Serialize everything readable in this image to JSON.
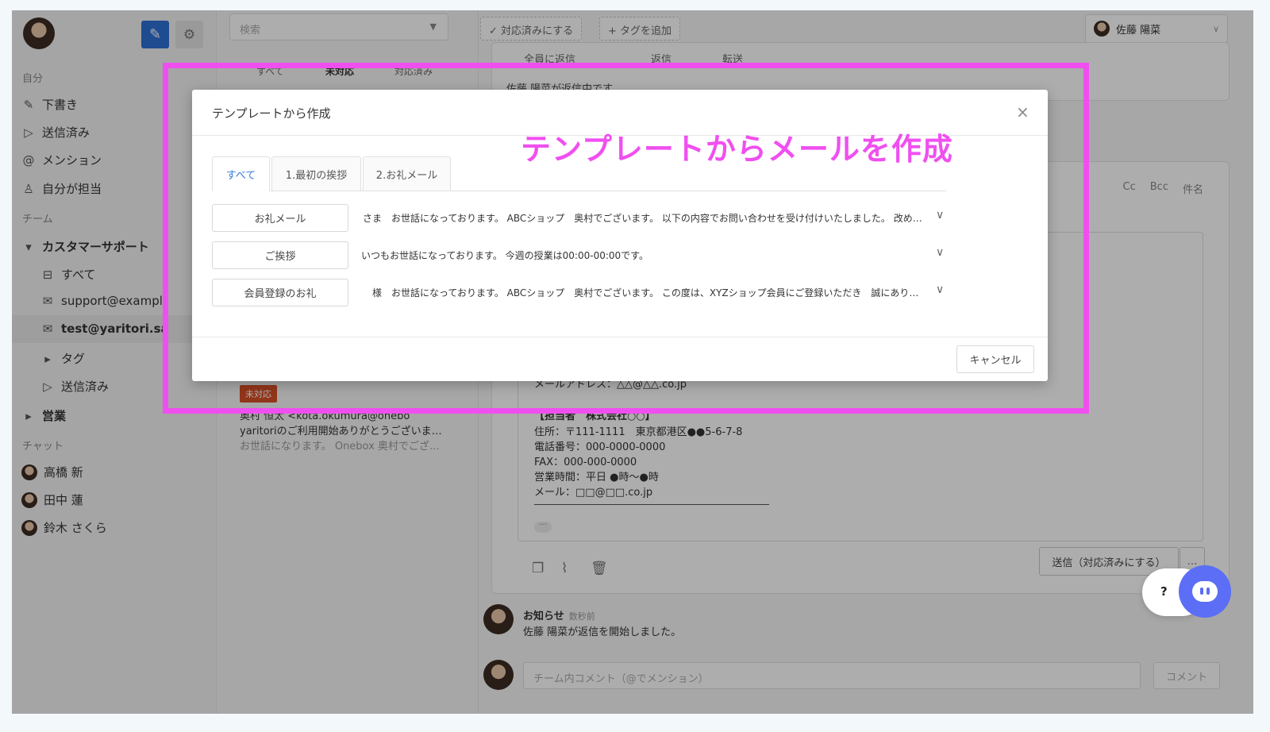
{
  "sidebar": {
    "section_self": "自分",
    "self_items": [
      {
        "label": "下書き",
        "icon": "pencil-icon"
      },
      {
        "label": "送信済み",
        "icon": "send-icon"
      },
      {
        "label": "メンション",
        "icon": "at-icon"
      },
      {
        "label": "自分が担当",
        "icon": "person-icon"
      }
    ],
    "section_team": "チーム",
    "team_name": "カスタマーサポート",
    "team_items": [
      {
        "label": "すべて",
        "icon": "inbox-icon"
      },
      {
        "label": "support@exampl",
        "icon": "mail-icon"
      },
      {
        "label": "test@yaritori.sa",
        "icon": "mail-icon"
      },
      {
        "label": "タグ",
        "icon": "caret-right-icon"
      },
      {
        "label": "送信済み",
        "icon": "send-icon"
      }
    ],
    "team_sales": "営業",
    "section_chat": "チャット",
    "chat_users": [
      "高橋 新",
      "田中 蓮",
      "鈴木 さくら"
    ]
  },
  "list": {
    "search_placeholder": "検索",
    "filter_tabs": [
      "すべて",
      "未対応",
      "対応済み"
    ],
    "item": {
      "status_tag": "未対応",
      "from": "奥村 恒太 <kota.okumura@onebo",
      "subject": "yaritoriのご利用開始ありがとうございま…",
      "snippet": "お世話になります。 Onebox 奥村でござ…"
    }
  },
  "main": {
    "mark_done": "対応済みにする",
    "add_tag": "タグを追加",
    "assignee": "佐藤 陽菜",
    "reply_all": "全員に返信",
    "reply": "返信",
    "forward": "転送",
    "replying_status": "佐藤 陽菜が返信中です。",
    "compose_fields": [
      "Cc",
      "Bcc",
      "件名"
    ],
    "signature": [
      "メールアドレス：△△@△△.co.jp",
      "【担当者　株式会社○○】",
      "住所：〒111-1111　東京都港区●●5-6-7-8",
      "電話番号：000-0000-0000",
      "FAX：000-000-0000",
      "営業時間：平日 ●時〜●時",
      "メール：□□@□□.co.jp"
    ],
    "send_button": "送信（対応済みにする）",
    "send_more": "…",
    "notice_title": "お知らせ",
    "notice_time": "数秒前",
    "notice_body": "佐藤 陽菜が返信を開始しました。",
    "comment_placeholder": "チーム内コメント（@でメンション）",
    "comment_button": "コメント"
  },
  "help": {
    "question_mark": "?"
  },
  "modal": {
    "title": "テンプレートから作成",
    "close": "×",
    "annotation": "テンプレートからメールを作成",
    "tabs": [
      "すべて",
      "1.最初の挨拶",
      "2.お礼メール"
    ],
    "templates": [
      {
        "name": "お礼メール",
        "preview": "さま　お世話になっております。 ABCショップ　奥村でございます。 以下の内容でお問い合わせを受け付けいたしました。 改めて、..."
      },
      {
        "name": "ご挨拶",
        "preview": "いつもお世話になっております。 今週の授業は00:00-00:00です。"
      },
      {
        "name": "会員登録のお礼",
        "preview": "様　お世話になっております。 ABCショップ　奥村でございます。 この度は、XYZショップ会員にご登録いただき　誠にありがとうござ..."
      }
    ],
    "cancel": "キャンセル"
  },
  "colors": {
    "accent_blue": "#2f6fd6",
    "annotation_magenta": "#f04ff0",
    "status_red": "#d84e27",
    "help_purple": "#5b6ef5"
  }
}
